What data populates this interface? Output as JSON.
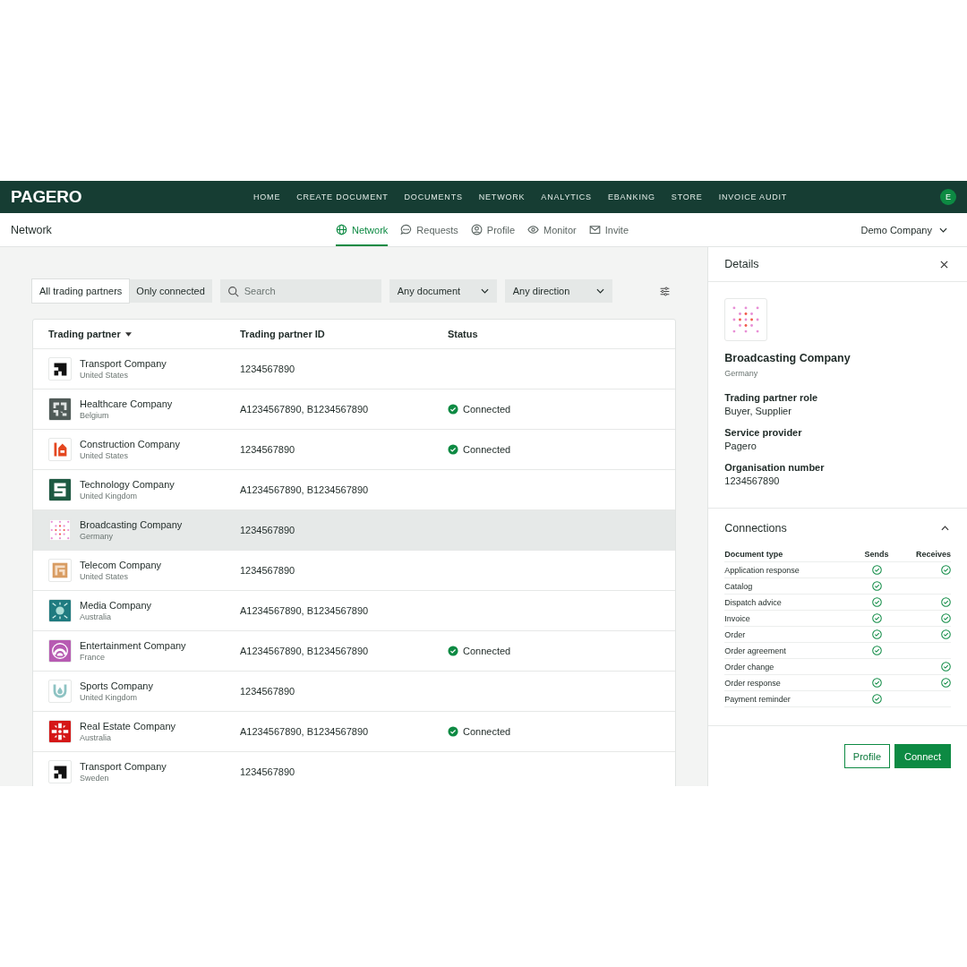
{
  "brand": "PAGERO",
  "nav": [
    "HOME",
    "CREATE DOCUMENT",
    "DOCUMENTS",
    "NETWORK",
    "ANALYTICS",
    "EBANKING",
    "STORE",
    "INVOICE AUDIT"
  ],
  "avatar": "E",
  "page_title": "Network",
  "tabs": [
    {
      "label": "Network",
      "kind": "globe",
      "selected": true
    },
    {
      "label": "Requests",
      "kind": "chat",
      "selected": false
    },
    {
      "label": "Profile",
      "kind": "person",
      "selected": false
    },
    {
      "label": "Monitor",
      "kind": "eye",
      "selected": false
    },
    {
      "label": "Invite",
      "kind": "mail",
      "selected": false
    }
  ],
  "company_menu": "Demo Company",
  "filters": {
    "segments": [
      {
        "label": "All trading partners",
        "selected": true
      },
      {
        "label": "Only connected",
        "selected": false
      }
    ],
    "search": {
      "placeholder": "Search"
    },
    "dropdowns": [
      "Any document",
      "Any direction"
    ]
  },
  "table": {
    "columns": [
      "Trading partner",
      "Trading partner ID",
      "Status"
    ],
    "rows": [
      {
        "name": "Transport Company",
        "country": "United States",
        "id": "1234567890",
        "kind": "blocks",
        "selected": false
      },
      {
        "name": "Healthcare Company",
        "country": "Belgium",
        "id": "A1234567890, B1234567890",
        "status": "Connected",
        "kind": "maze",
        "selected": false
      },
      {
        "name": "Construction Company",
        "country": "United States",
        "id": "1234567890",
        "status": "Connected",
        "kind": "house",
        "selected": false
      },
      {
        "name": "Technology Company",
        "country": "United Kingdom",
        "id": "A1234567890, B1234567890",
        "kind": "s-mark",
        "selected": false
      },
      {
        "name": "Broadcasting Company",
        "country": "Germany",
        "id": "1234567890",
        "kind": "dots",
        "selected": true
      },
      {
        "name": "Telecom Company",
        "country": "United States",
        "id": "1234567890",
        "kind": "spiral",
        "selected": false
      },
      {
        "name": "Media Company",
        "country": "Australia",
        "id": "A1234567890, B1234567890",
        "kind": "flower",
        "selected": false
      },
      {
        "name": "Entertainment Company",
        "country": "France",
        "id": "A1234567890, B1234567890",
        "status": "Connected",
        "kind": "arch",
        "selected": false
      },
      {
        "name": "Sports Company",
        "country": "United Kingdom",
        "id": "1234567890",
        "kind": "drop",
        "selected": false
      },
      {
        "name": "Real Estate Company",
        "country": "Australia",
        "id": "A1234567890, B1234567890",
        "status": "Connected",
        "kind": "cross",
        "selected": false
      },
      {
        "name": "Transport Company",
        "country": "Sweden",
        "id": "1234567890",
        "kind": "blocks",
        "selected": false
      }
    ]
  },
  "details": {
    "title": "Details",
    "kind": "dots",
    "name": "Broadcasting Company",
    "country": "Germany",
    "fields": [
      {
        "label": "Trading partner role",
        "value": "Buyer, Supplier"
      },
      {
        "label": "Service provider",
        "value": "Pagero"
      },
      {
        "label": "Organisation number",
        "value": "1234567890"
      }
    ],
    "connections": {
      "title": "Connections",
      "expanded": true,
      "columns": [
        "Document type",
        "Sends",
        "Receives"
      ],
      "rows": [
        {
          "type": "Application response",
          "sends": true,
          "receives": true
        },
        {
          "type": "Catalog",
          "sends": true,
          "receives": false
        },
        {
          "type": "Dispatch advice",
          "sends": true,
          "receives": true
        },
        {
          "type": "Invoice",
          "sends": true,
          "receives": true
        },
        {
          "type": "Order",
          "sends": true,
          "receives": true
        },
        {
          "type": "Order agreement",
          "sends": true,
          "receives": false
        },
        {
          "type": "Order change",
          "sends": false,
          "receives": true
        },
        {
          "type": "Order response",
          "sends": true,
          "receives": true
        },
        {
          "type": "Payment reminder",
          "sends": true,
          "receives": false
        }
      ]
    },
    "buttons": [
      "Profile",
      "Connect"
    ]
  }
}
